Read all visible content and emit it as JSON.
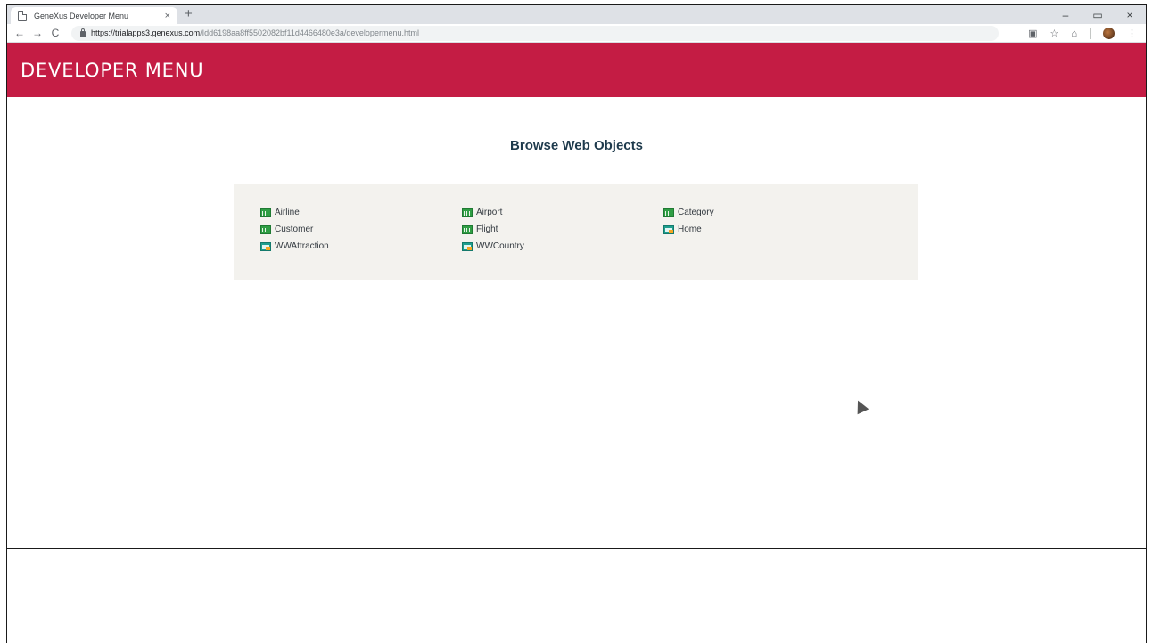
{
  "browser": {
    "tab_title": "GeneXus Developer Menu",
    "tab_close": "×",
    "new_tab": "+",
    "url_host": "https://trialapps3.genexus.com",
    "url_path": "/Idd6198aa8ff5502082bf11d4466480e3a/developermenu.html",
    "back_icon": "←",
    "forward_icon": "→",
    "reload_icon": "C",
    "window_controls": [
      "–",
      "▭",
      "×"
    ]
  },
  "header": {
    "title": "DEVELOPER MENU",
    "background_color": "#c41c44"
  },
  "main": {
    "section_title": "Browse Web Objects",
    "objects": [
      {
        "label": "Airline",
        "icon": "transaction-icon"
      },
      {
        "label": "Airport",
        "icon": "transaction-icon"
      },
      {
        "label": "Category",
        "icon": "transaction-icon"
      },
      {
        "label": "Customer",
        "icon": "transaction-icon"
      },
      {
        "label": "Flight",
        "icon": "transaction-icon"
      },
      {
        "label": "Home",
        "icon": "webpanel-icon"
      },
      {
        "label": "WWAttraction",
        "icon": "webpanel-icon"
      },
      {
        "label": "WWCountry",
        "icon": "webpanel-icon"
      }
    ]
  }
}
